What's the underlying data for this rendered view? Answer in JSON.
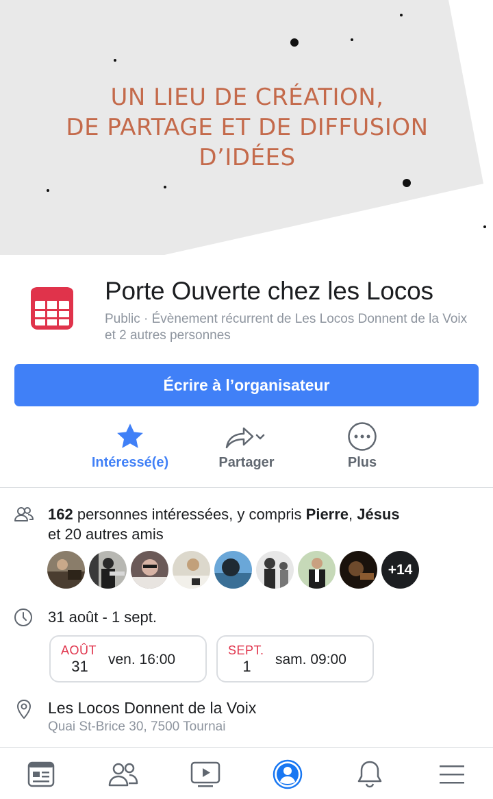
{
  "cover": {
    "lines": [
      "UN LIEU DE CRÉATION,",
      "DE PARTAGE ET DE DIFFUSION",
      "D’IDÉES"
    ],
    "text_color": "#c46a4b",
    "bg_color": "#e9e9e9"
  },
  "event": {
    "icon": "calendar-icon",
    "title": "Porte Ouverte chez les Locos",
    "subtitle": "Public · Évènement récurrent de Les Locos Donnent de la Voix et 2 autres personnes"
  },
  "primary_button": {
    "label": "Écrire à l’organisateur",
    "color": "#4080f7"
  },
  "actions": [
    {
      "label": "Intéressé(e)",
      "icon": "star-icon",
      "active": true
    },
    {
      "label": "Partager",
      "icon": "share-icon",
      "active": false
    },
    {
      "label": "Plus",
      "icon": "more-icon",
      "active": false
    }
  ],
  "interested": {
    "count": "162",
    "text_before": " personnes intéressées, y compris ",
    "friend1": "Pierre",
    "sep": ", ",
    "friend2": "Jésus",
    "line2": "et 20 autres amis",
    "more_badge": "+14"
  },
  "schedule": {
    "range": "31 août - 1 sept.",
    "occurrences": [
      {
        "month": "AOÛT",
        "day": "31",
        "time": "ven. 16:00"
      },
      {
        "month": "SEPT.",
        "day": "1",
        "time": "sam. 09:00"
      }
    ]
  },
  "location": {
    "name": "Les Locos Donnent de la Voix",
    "address": "Quai St-Brice 30, 7500 Tournai"
  },
  "tabbar": {
    "tabs": [
      "news-feed-icon",
      "friends-icon",
      "watch-icon",
      "profile-icon",
      "notifications-icon",
      "menu-icon"
    ],
    "active_color": "#1877f2"
  }
}
